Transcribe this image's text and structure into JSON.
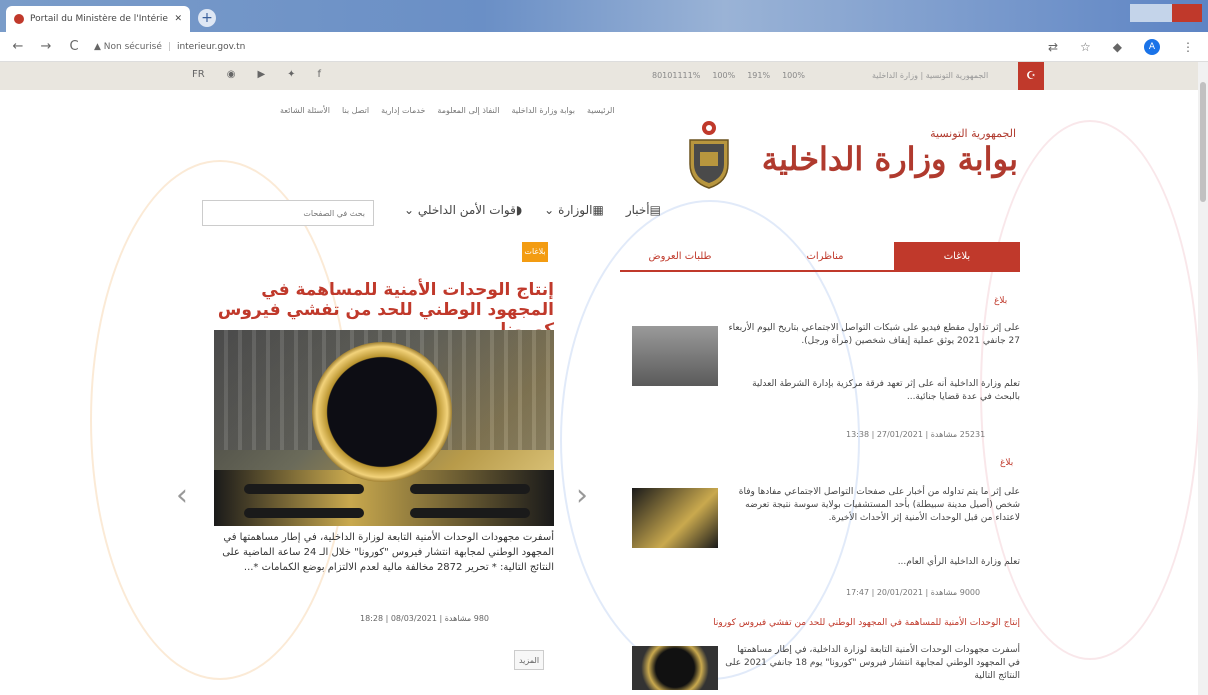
{
  "browser": {
    "tab_title": "Portail du Ministère de l'Intérieur",
    "new_tab": "+",
    "address_warning": "▲ Non sécurisé",
    "address_url": "interieur.gov.tn",
    "back": "←",
    "forward": "→",
    "reload": "C",
    "profile_initial": "A"
  },
  "site": {
    "social": [
      "FR",
      "rss",
      "yt",
      "tw",
      "f"
    ],
    "stats": [
      "80101111%",
      "100%",
      "191%",
      "100%"
    ],
    "republic_short": "الجمهورية التونسية | وزارة الداخلية",
    "breadcrumb": [
      "الرئيسية",
      "بوابة وزارة الداخلية",
      "النفاذ إلى المعلومة",
      "خدمات إدارية",
      "اتصل بنا",
      "الأسئلة الشائعة"
    ],
    "republic_name": "الجمهورية التونسية",
    "portal_title": "بوابة وزارة الداخلية",
    "search_placeholder": "بحث في الصفحات",
    "nav": [
      "أخبار",
      "الوزارة",
      "قوات الأمن الداخلي"
    ]
  },
  "tabs": [
    "بلاغات",
    "مناظرات",
    "طلبات العروض"
  ],
  "featured": {
    "badge": "بلاغات",
    "title": "إنتاج الوحدات الأمنية للمساهمة في المجهود الوطني للحد من تفشي فيروس كورونا",
    "description": "أسفرت مجهودات الوحدات الأمنية التابعة لوزارة الداخلية، في إطار مساهمتها في المجهود الوطني لمجابهة انتشار فيروس \"كورونا\" خلال الـ 24 ساعة الماضية على النتائج التالية: * تحرير 2872 مخالفة مالية لعدم الالتزام بوضع الكمامات *...",
    "meta": "980 مشاهدة | 08/03/2021 | 18:28",
    "more": "المزيد"
  },
  "news": [
    {
      "label": "بلاغ",
      "text": "على إثر تداول مقطع فيديو على شبكات التواصل الاجتماعي بتاريخ اليوم الأربعاء 27 جانفي 2021 يوثق عملية إيقاف شخصين (مرأة ورجل).",
      "text2": "تعلم وزارة الداخلية أنه على إثر تعهد فرقة مركزية بإدارة الشرطة العدلية بالبحث في عدة قضايا جنائية...",
      "meta": "25231 مشاهدة | 27/01/2021 | 13:38"
    },
    {
      "label": "بلاغ",
      "text": "على إثر ما يتم تداوله من أخبار على صفحات التواصل الاجتماعي مفادها وفاة شخص (أصيل مدينة سبيطلة) بأحد المستشفيات بولاية سوسة نتيجة تعرضه لاعتداء من قبل الوحدات الأمنية إثر الأحداث الأخيرة.",
      "text2": "تعلم وزارة الداخلية الرأي العام...",
      "meta": "9000 مشاهدة | 20/01/2021 | 17:47"
    }
  ],
  "headline2": "إنتاج الوحدات الأمنية للمساهمة في المجهود الوطني للحد من تفشي فيروس كورونا",
  "news3_text": "أسفرت مجهودات الوحدات الأمنية التابعة لوزارة الداخلية، في إطار مساهمتها في المجهود الوطني لمجابهة انتشار فيروس \"كورونا\" يوم 18 جانفي 2021 على النتائج التالية",
  "arrows": {
    "prev": "‹",
    "next": "›"
  }
}
